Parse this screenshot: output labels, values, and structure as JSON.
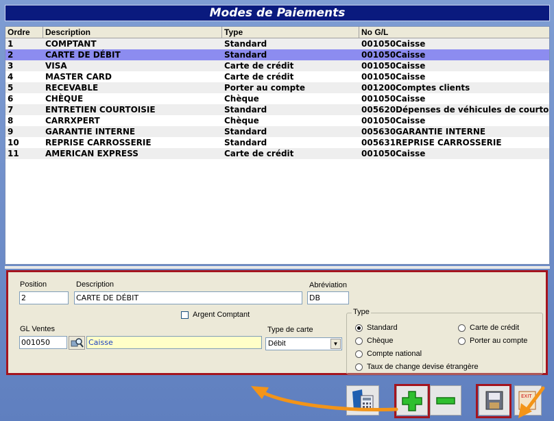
{
  "window": {
    "title": "Modes de Paiements"
  },
  "grid": {
    "columns": [
      "Ordre",
      "Description",
      "Type",
      "No G/L"
    ],
    "rows": [
      {
        "ordre": "1",
        "desc": "COMPTANT",
        "type": "Standard",
        "gl": "001050",
        "gldesc": "Caisse"
      },
      {
        "ordre": "2",
        "desc": "CARTE DE DÉBIT",
        "type": "Standard",
        "gl": "001050",
        "gldesc": "Caisse"
      },
      {
        "ordre": "3",
        "desc": "VISA",
        "type": "Carte de crédit",
        "gl": "001050",
        "gldesc": "Caisse"
      },
      {
        "ordre": "4",
        "desc": "MASTER CARD",
        "type": "Carte de crédit",
        "gl": "001050",
        "gldesc": "Caisse"
      },
      {
        "ordre": "5",
        "desc": "RECEVABLE",
        "type": "Porter au compte",
        "gl": "001200",
        "gldesc": "Comptes clients"
      },
      {
        "ordre": "6",
        "desc": "CHÈQUE",
        "type": "Chèque",
        "gl": "001050",
        "gldesc": "Caisse"
      },
      {
        "ordre": "7",
        "desc": "ENTRETIEN COURTOISIE",
        "type": "Standard",
        "gl": "005620",
        "gldesc": "Dépenses de véhicules de courtoisie"
      },
      {
        "ordre": "8",
        "desc": "CARRXPERT",
        "type": "Chèque",
        "gl": "001050",
        "gldesc": "Caisse"
      },
      {
        "ordre": "9",
        "desc": "GARANTIE INTERNE",
        "type": "Standard",
        "gl": "005630",
        "gldesc": "GARANTIE INTERNE"
      },
      {
        "ordre": "10",
        "desc": "REPRISE CARROSSERIE",
        "type": "Standard",
        "gl": "005631",
        "gldesc": "REPRISE CARROSSERIE"
      },
      {
        "ordre": "11",
        "desc": "AMERICAN EXPRESS",
        "type": "Carte de crédit",
        "gl": "001050",
        "gldesc": "Caisse"
      }
    ],
    "selected_index": 1
  },
  "form": {
    "position_label": "Position",
    "position_value": "2",
    "description_label": "Description",
    "description_value": "CARTE DE DÉBIT",
    "abbrev_label": "Abréviation",
    "abbrev_value": "DB",
    "cash_label": "Argent Comptant",
    "cash_checked": false,
    "gl_label": "GL Ventes",
    "gl_value": "001050",
    "gl_desc": "Caisse",
    "card_type_label": "Type de carte",
    "card_type_value": "Débit",
    "type_group_label": "Type",
    "type_options": [
      "Standard",
      "Carte de crédit",
      "Chèque",
      "Porter au compte",
      "Compte national",
      "Taux de change devise étrangère"
    ],
    "type_selected": "Standard"
  },
  "toolbar": {
    "buttons": [
      "calculator-icon",
      "plus-icon",
      "minus-icon",
      "save-disk-icon",
      "exit-icon"
    ],
    "exit_text": "EXIT"
  },
  "colors": {
    "title_bg": "#0a1a7e",
    "selected_row": "#8c8cf0",
    "highlight": "#a4141e",
    "arrow": "#f39418"
  }
}
